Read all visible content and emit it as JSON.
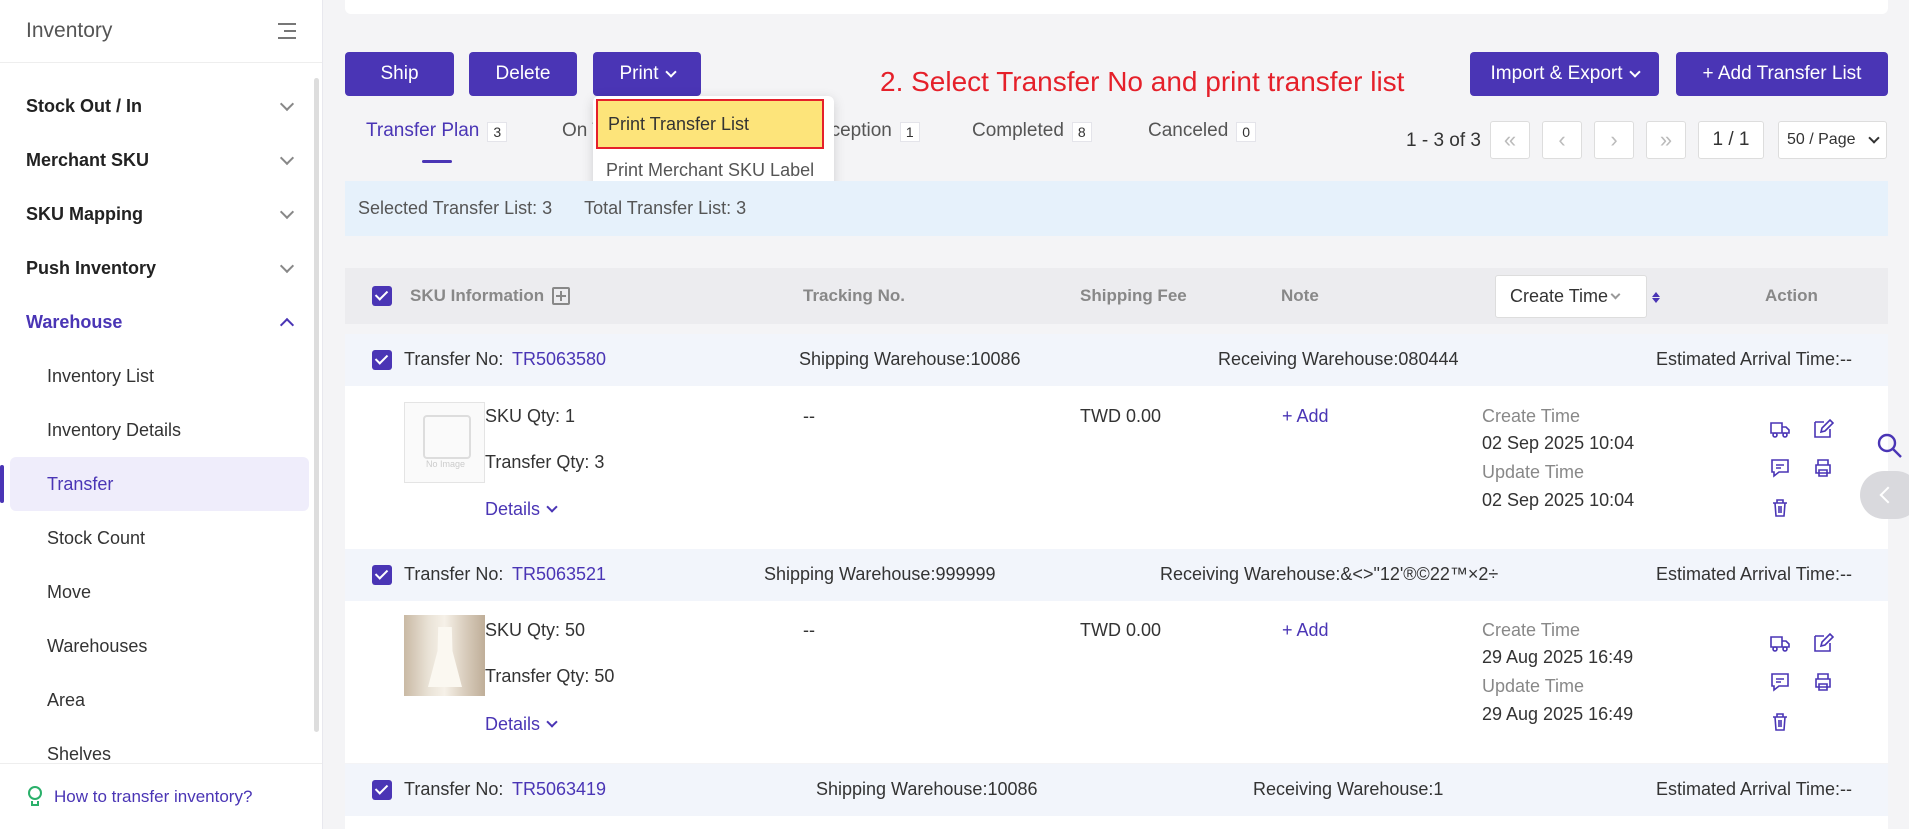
{
  "sidebar": {
    "title": "Inventory",
    "menu": [
      {
        "label": "Stock Out / In"
      },
      {
        "label": "Merchant SKU"
      },
      {
        "label": "SKU Mapping"
      },
      {
        "label": "Push Inventory"
      },
      {
        "label": "Warehouse"
      }
    ],
    "submenu": [
      {
        "label": "Inventory List"
      },
      {
        "label": "Inventory Details"
      },
      {
        "label": "Transfer"
      },
      {
        "label": "Stock Count"
      },
      {
        "label": "Move"
      },
      {
        "label": "Warehouses"
      },
      {
        "label": "Area"
      },
      {
        "label": "Shelves"
      }
    ],
    "help_link": "How to transfer inventory?"
  },
  "toolbar": {
    "ship": "Ship",
    "delete": "Delete",
    "print": "Print",
    "import_export": "Import & Export",
    "add_transfer": "+ Add Transfer List"
  },
  "annotation": "2. Select Transfer No and print transfer list",
  "print_menu": {
    "items": [
      "Print Transfer List",
      "Print Merchant SKU Label"
    ]
  },
  "tabs": [
    {
      "label": "Transfer Plan",
      "count": "3"
    },
    {
      "label": "On T",
      "count": ""
    },
    {
      "label": "eception",
      "count": "1"
    },
    {
      "label": "Completed",
      "count": "8"
    },
    {
      "label": "Canceled",
      "count": "0"
    }
  ],
  "pagination": {
    "info": "1 - 3 of 3",
    "page": "1 / 1",
    "page_size": "50 / Page"
  },
  "selection": {
    "selected": "Selected Transfer List: 3",
    "total": "Total Transfer List: 3"
  },
  "table": {
    "columns": {
      "sku": "SKU Information",
      "tracking": "Tracking No.",
      "fee": "Shipping Fee",
      "note": "Note",
      "create_time": "Create Time",
      "action": "Action"
    },
    "rows": [
      {
        "transfer_label": "Transfer No:",
        "transfer_no": "TR5063580",
        "shipping": "Shipping Warehouse:10086",
        "receiving": "Receiving Warehouse:080444",
        "eta": "Estimated Arrival Time:--",
        "sku_qty": "SKU Qty: 1",
        "transfer_qty": "Transfer Qty: 3",
        "details": "Details",
        "tracking": "--",
        "fee": "TWD 0.00",
        "note_add": "+ Add",
        "create_label": "Create Time",
        "create_time": "02 Sep 2025 10:04",
        "update_label": "Update Time",
        "update_time": "02 Sep 2025 10:04"
      },
      {
        "transfer_label": "Transfer No:",
        "transfer_no": "TR5063521",
        "shipping": "Shipping Warehouse:999999",
        "receiving": "Receiving Warehouse:&<>\"12'®©22™×2÷",
        "eta": "Estimated Arrival Time:--",
        "sku_qty": "SKU Qty: 50",
        "transfer_qty": "Transfer Qty: 50",
        "details": "Details",
        "tracking": "--",
        "fee": "TWD 0.00",
        "note_add": "+ Add",
        "create_label": "Create Time",
        "create_time": "29 Aug 2025 16:49",
        "update_label": "Update Time",
        "update_time": "29 Aug 2025 16:49"
      },
      {
        "transfer_label": "Transfer No:",
        "transfer_no": "TR5063419",
        "shipping": "Shipping Warehouse:10086",
        "receiving": "Receiving Warehouse:1",
        "eta": "Estimated Arrival Time:--"
      }
    ]
  },
  "colors": {
    "accent": "#4a35b5",
    "highlight": "#fde47a",
    "annotation": "#e5202a"
  }
}
